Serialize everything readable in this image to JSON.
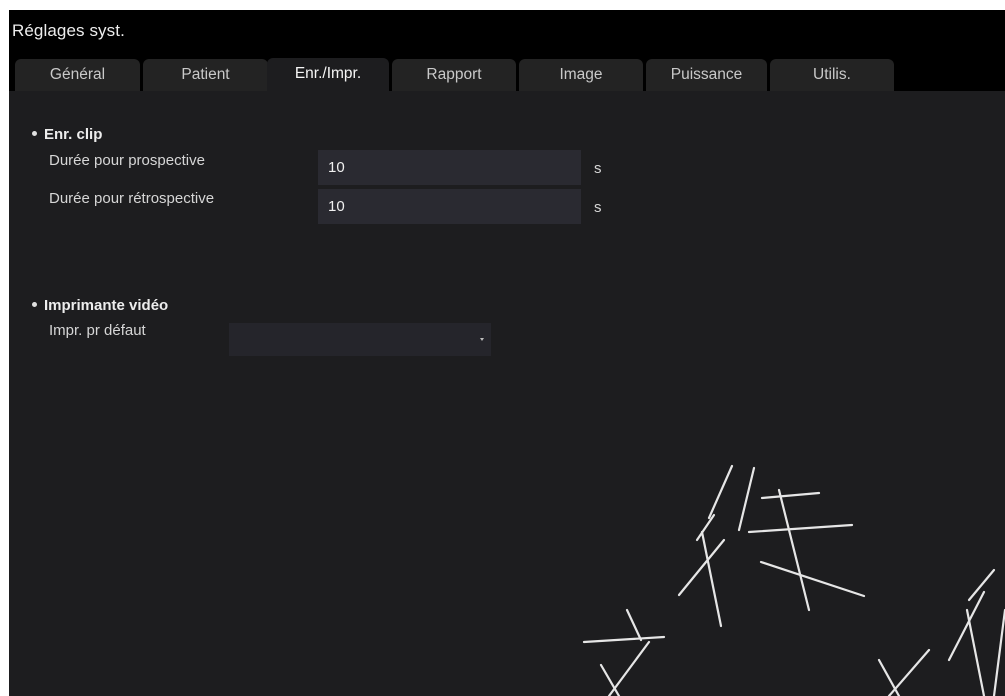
{
  "window": {
    "title": "Réglages syst."
  },
  "tabs": [
    {
      "label": "Général",
      "active": false
    },
    {
      "label": "Patient",
      "active": false
    },
    {
      "label": "Enr./Impr.",
      "active": true
    },
    {
      "label": "Rapport",
      "active": false
    },
    {
      "label": "Image",
      "active": false
    },
    {
      "label": "Puissance",
      "active": false
    },
    {
      "label": "Utilis.",
      "active": false
    }
  ],
  "clip_section": {
    "title": "Enr. clip",
    "prospective": {
      "label": "Durée pour prospective",
      "value": "10",
      "unit": "s"
    },
    "retrospective": {
      "label": "Durée pour rétrospective",
      "value": "10",
      "unit": "s"
    }
  },
  "printer_section": {
    "title": "Imprimante vidéo",
    "default_printer": {
      "label": "Impr. pr défaut",
      "value": ""
    }
  },
  "colors": {
    "background": "#1d1d1f",
    "title_bar": "#000000",
    "tab_inactive": "#232323",
    "input_bg": "#2a2a31"
  }
}
